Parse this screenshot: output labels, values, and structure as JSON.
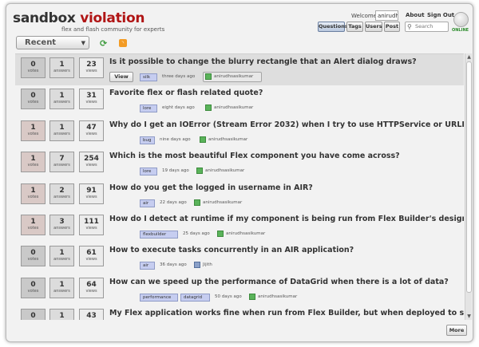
{
  "app": {
    "logo_part1": "sandbox",
    "logo_part2": "violation",
    "tagline": "flex and flash community for experts",
    "welcome_label": "Welcome",
    "username": "anirudhs",
    "about_label": "About",
    "signout_label": "Sign Out",
    "online_label": "ONLINE",
    "accent_color": "#b01515"
  },
  "nav": {
    "questions": "Questions",
    "tags": "Tags",
    "users": "Users",
    "post": "Post",
    "search_placeholder": "Search"
  },
  "toolbar": {
    "filter_selected": "Recent",
    "refresh_icon": "refresh-icon",
    "rss_icon": "rss-icon"
  },
  "labels": {
    "votes": "votes",
    "answers": "answers",
    "views": "views",
    "view_button": "View",
    "more_button": "More"
  },
  "questions": [
    {
      "votes": "0",
      "answers": "1",
      "views": "23",
      "title": "Is it possible to change the blurry rectangle that an Alert dialog draws?",
      "tags": [
        "silk"
      ],
      "when": "three days ago",
      "author": "anirudhsasikumar"
    },
    {
      "votes": "0",
      "answers": "1",
      "views": "31",
      "title": "Favorite flex or flash related quote?",
      "tags": [
        "lore"
      ],
      "when": "eight days ago",
      "author": "anirudhsasikumar"
    },
    {
      "votes": "1",
      "answers": "1",
      "views": "47",
      "title": "Why do I get an IOError (Stream Error 2032) when I try to use HTTPService or URLLoader?",
      "tags": [
        "bug"
      ],
      "when": "nine days ago",
      "author": "anirudhsasikumar"
    },
    {
      "votes": "1",
      "answers": "7",
      "views": "254",
      "title": "Which is the most beautiful Flex component you have come across?",
      "tags": [
        "lore"
      ],
      "when": "19 days ago",
      "author": "anirudhsasikumar"
    },
    {
      "votes": "1",
      "answers": "2",
      "views": "91",
      "title": "How do you get the logged in username in AIR?",
      "tags": [
        "air"
      ],
      "when": "22 days ago",
      "author": "anirudhsasikumar"
    },
    {
      "votes": "1",
      "answers": "3",
      "views": "111",
      "title": "How do I detect at runtime if my component is being run from Flex Builder's design view?",
      "tags": [
        "flexbuilder"
      ],
      "when": "25 days ago",
      "author": "anirudhsasikumar"
    },
    {
      "votes": "0",
      "answers": "1",
      "views": "61",
      "title": "How to execute tasks concurrently in an AIR application?",
      "tags": [
        "air"
      ],
      "when": "36 days ago",
      "author": "Jijith"
    },
    {
      "votes": "0",
      "answers": "1",
      "views": "64",
      "title": "How can we speed up the performance of DataGrid when there is a lot of data?",
      "tags": [
        "performance",
        "datagrid"
      ],
      "when": "50 days ago",
      "author": "anirudhsasikumar"
    },
    {
      "votes": "0",
      "answers": "1",
      "views": "43",
      "title": "My Flex application works fine when run from Flex Builder, but when deployed to server, I",
      "tags": [],
      "when": "",
      "author": ""
    }
  ]
}
